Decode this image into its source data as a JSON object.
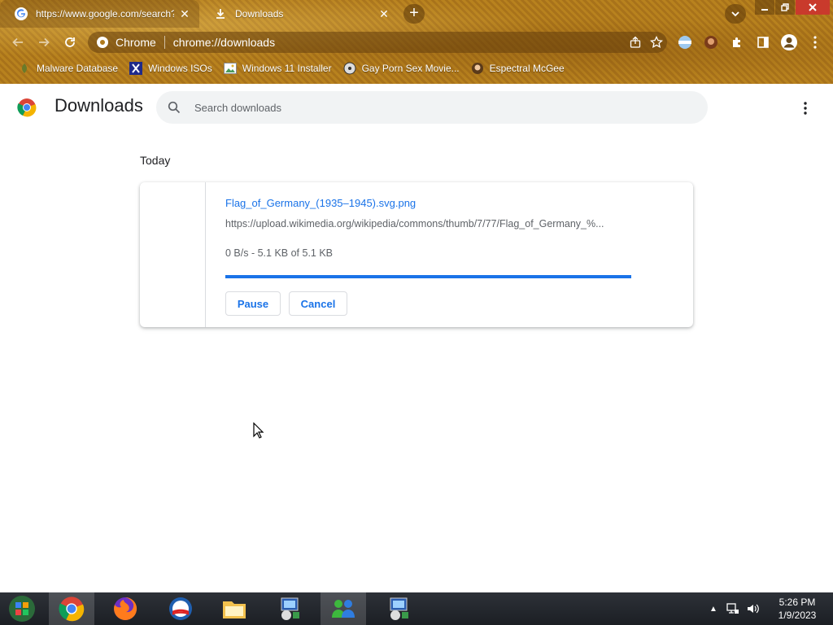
{
  "browser": {
    "tabs": [
      {
        "title": "https://www.google.com/search?q",
        "active": true
      },
      {
        "title": "Downloads",
        "active": false
      }
    ],
    "omnibox": {
      "site_label": "Chrome",
      "url": "chrome://downloads"
    },
    "bookmarks": [
      {
        "label": "Malware Database",
        "icon": "leaf-icon"
      },
      {
        "label": "Windows ISOs",
        "icon": "x-icon"
      },
      {
        "label": "Windows 11 Installer",
        "icon": "image-icon"
      },
      {
        "label": "Gay Porn Sex Movie...",
        "icon": "disc-icon"
      },
      {
        "label": "Espectral McGee",
        "icon": "avatar-icon"
      }
    ]
  },
  "page": {
    "title": "Downloads",
    "search_placeholder": "Search downloads",
    "date_header": "Today",
    "download": {
      "filename": "Flag_of_Germany_(1935–1945).svg.png",
      "url": "https://upload.wikimedia.org/wikipedia/commons/thumb/7/77/Flag_of_Germany_%...",
      "status": "0 B/s - 5.1 KB of 5.1 KB",
      "progress": 1.0,
      "pause_label": "Pause",
      "cancel_label": "Cancel"
    }
  },
  "taskbar": {
    "time": "5:26 PM",
    "date": "1/9/2023"
  },
  "colors": {
    "accent": "#1a73e8",
    "frame": "#b07a1c"
  }
}
